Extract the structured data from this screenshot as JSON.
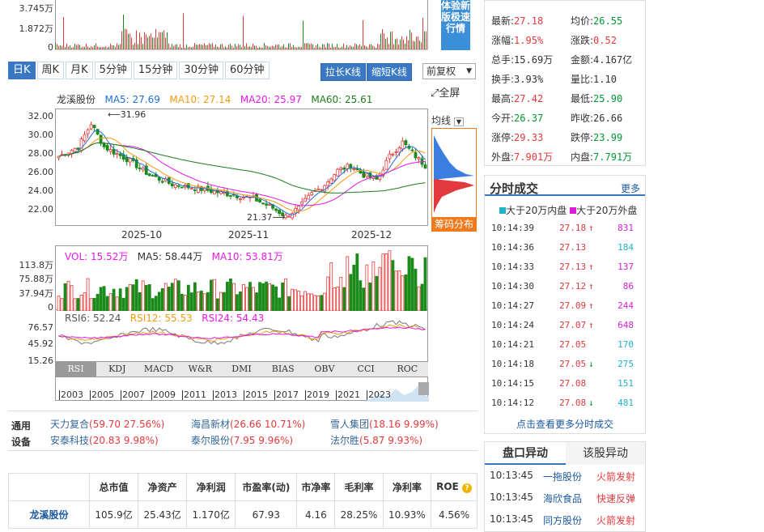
{
  "top_volume": {
    "y_labels": [
      "3.745万",
      "1.872万",
      "0"
    ]
  },
  "ad": {
    "text": "体验新版极速行情"
  },
  "period_tabs": [
    "日K",
    "周K",
    "月K",
    "5分钟",
    "15分钟",
    "30分钟",
    "60分钟"
  ],
  "buttons": {
    "stretch": "拉长K线",
    "shrink": "缩短K线",
    "adjust": "前复权",
    "fullscreen": "全屏"
  },
  "k_legend": {
    "name": "龙溪股份",
    "ma5": "MA5: 27.69",
    "ma10": "MA10: 27.14",
    "ma20": "MA20: 25.97",
    "ma60": "MA60: 25.61"
  },
  "k_axis": {
    "y": [
      "32.00",
      "30.00",
      "28.00",
      "26.00",
      "24.00",
      "22.00"
    ],
    "x": [
      "2025-10",
      "2025-11",
      "2025-12"
    ],
    "max_label": "31.96",
    "min_label": "21.37"
  },
  "ma_select": "均线",
  "chip_button": "筹码分布",
  "vol_legend": {
    "vol": "VOL: 15.52万",
    "ma5": "MA5: 58.44万",
    "ma10": "MA10: 53.81万"
  },
  "vol_axis": [
    "113.8万",
    "75.88万",
    "37.94万",
    "0"
  ],
  "rsi_legend": {
    "rsi6": "RSI6: 52.24",
    "rsi12": "RSI12: 55.53",
    "rsi24": "RSI24: 54.43"
  },
  "rsi_axis": [
    "76.57",
    "45.92",
    "15.26"
  ],
  "indicator_tabs": [
    "RSI",
    "KDJ",
    "MACD",
    "W&R",
    "DMI",
    "BIAS",
    "OBV",
    "CCI",
    "ROC"
  ],
  "timeline_years": [
    "2003",
    "2005",
    "2007",
    "2009",
    "2011",
    "2013",
    "2015",
    "2017",
    "2019",
    "2021",
    "2023"
  ],
  "related": {
    "label": "通用设备",
    "items": [
      {
        "name": "天力复合",
        "detail": "(59.70 27.56%)"
      },
      {
        "name": "海昌新材",
        "detail": "(26.66 10.71%)"
      },
      {
        "name": "雪人集团",
        "detail": "(18.16 9.99%)"
      },
      {
        "name": "安泰科技",
        "detail": "(20.83 9.98%)"
      },
      {
        "name": "泰尔股份",
        "detail": "(7.95 9.96%)"
      },
      {
        "name": "法尔胜",
        "detail": "(5.87 9.93%)"
      }
    ]
  },
  "fundamentals": {
    "headers": [
      "",
      "总市值",
      "净资产",
      "净利润",
      "市盈率(动)",
      "市净率",
      "毛利率",
      "净利率",
      "ROE"
    ],
    "row": [
      "龙溪股份",
      "105.9亿",
      "25.43亿",
      "1.170亿",
      "67.93",
      "4.16",
      "28.25%",
      "10.93%",
      "4.56%"
    ]
  },
  "quote": [
    {
      "k": "最新:",
      "v": "27.18",
      "c": "red",
      "k2": "均价:",
      "v2": "26.55",
      "c2": "green"
    },
    {
      "k": "涨幅:",
      "v": "1.95%",
      "c": "red",
      "k2": "涨跌:",
      "v2": "0.52",
      "c2": "red"
    },
    {
      "k": "总手:",
      "v": "15.69万",
      "c": "",
      "k2": "金额:",
      "v2": "4.167亿",
      "c2": ""
    },
    {
      "k": "换手:",
      "v": "3.93%",
      "c": "",
      "k2": "量比:",
      "v2": "1.10",
      "c2": ""
    },
    {
      "k": "最高:",
      "v": "27.42",
      "c": "red",
      "k2": "最低:",
      "v2": "25.90",
      "c2": "green"
    },
    {
      "k": "今开:",
      "v": "26.37",
      "c": "green",
      "k2": "昨收:",
      "v2": "26.66",
      "c2": ""
    },
    {
      "k": "涨停:",
      "v": "29.33",
      "c": "red",
      "k2": "跌停:",
      "v2": "23.99",
      "c2": "green"
    },
    {
      "k": "外盘:",
      "v": "7.901万",
      "c": "red",
      "k2": "内盘:",
      "v2": "7.791万",
      "c2": "green"
    }
  ],
  "trades": {
    "title": "分时成交",
    "more": "更多",
    "legend_in": "大于20万内盘",
    "legend_out": "大于20万外盘",
    "rows": [
      {
        "t": "10:14:39",
        "p": "27.18",
        "arrow": "↑",
        "v": "831",
        "c": "purple"
      },
      {
        "t": "10:14:36",
        "p": "27.13",
        "arrow": "",
        "v": "184",
        "c": "cyan"
      },
      {
        "t": "10:14:33",
        "p": "27.13",
        "arrow": "↑",
        "v": "137",
        "c": "purple"
      },
      {
        "t": "10:14:30",
        "p": "27.12",
        "arrow": "↑",
        "v": "86",
        "c": "purple"
      },
      {
        "t": "10:14:27",
        "p": "27.09",
        "arrow": "↑",
        "v": "244",
        "c": "purple"
      },
      {
        "t": "10:14:24",
        "p": "27.07",
        "arrow": "↑",
        "v": "648",
        "c": "purple"
      },
      {
        "t": "10:14:21",
        "p": "27.05",
        "arrow": "",
        "v": "170",
        "c": "cyan"
      },
      {
        "t": "10:14:18",
        "p": "27.05",
        "arrow": "↓",
        "v": "275",
        "c": "cyan"
      },
      {
        "t": "10:14:15",
        "p": "27.08",
        "arrow": "",
        "v": "151",
        "c": "cyan"
      },
      {
        "t": "10:14:12",
        "p": "27.08",
        "arrow": "↓",
        "v": "481",
        "c": "cyan"
      }
    ],
    "footer": "点击查看更多分时成交"
  },
  "abnormal": {
    "tab_active": "盘口异动",
    "tab_other": "该股异动",
    "rows": [
      {
        "t": "10:13:45",
        "name": "一拖股份",
        "event": "火箭发射"
      },
      {
        "t": "10:13:45",
        "name": "海欣食品",
        "event": "快速反弹"
      },
      {
        "t": "10:13:45",
        "name": "同方股份",
        "event": "火箭发射"
      }
    ]
  }
}
